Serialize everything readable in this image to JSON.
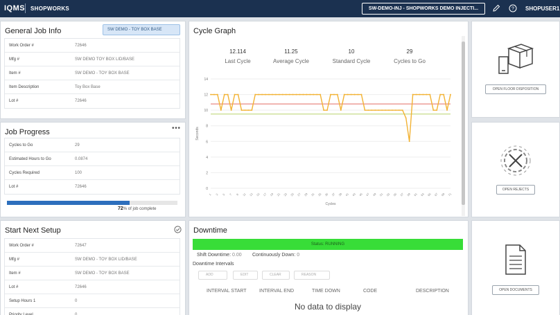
{
  "header": {
    "brand": "IQMS",
    "product": "SHOPWORKS",
    "device": "SW-DEMO-INJ - SHOPWORKS DEMO INJECTI...",
    "user": "SHOPUSER1",
    "edit_icon": "pencil-icon",
    "help_icon": "help-circle-icon"
  },
  "general_job": {
    "title": "General Job Info",
    "selector": "SW DEMO - TOY BOX BASE",
    "rows": [
      {
        "label": "Work Order #",
        "value": "72646"
      },
      {
        "label": "Mfg #",
        "value": "SW DEMO TOY BOX LID/BASE"
      },
      {
        "label": "Item #",
        "value": "SW DEMO - TOY BOX BASE"
      },
      {
        "label": "Item Description",
        "value": "Toy Box Base"
      },
      {
        "label": "Lot #",
        "value": "72646"
      }
    ]
  },
  "job_progress": {
    "title": "Job Progress",
    "rows": [
      {
        "label": "Cycles to Go",
        "value": "29"
      },
      {
        "label": "Estimated Hours to Go",
        "value": "0.0874"
      },
      {
        "label": "Cycles Required",
        "value": "100"
      },
      {
        "label": "Lot #",
        "value": "72646"
      }
    ],
    "percent": 72,
    "percent_label": "72",
    "complete_text": "% of job complete"
  },
  "next_setup": {
    "title": "Start Next Setup",
    "rows": [
      {
        "label": "Work Order #",
        "value": "72647"
      },
      {
        "label": "Mfg #",
        "value": "SW DEMO - TOY BOX LID/BASE"
      },
      {
        "label": "Item #",
        "value": "SW DEMO - TOY BOX BASE"
      },
      {
        "label": "Lot #",
        "value": "72646"
      },
      {
        "label": "Setup Hours 1",
        "value": "0"
      },
      {
        "label": "Priority Level",
        "value": "0"
      }
    ]
  },
  "cycle_graph": {
    "title": "Cycle Graph",
    "stats": [
      {
        "value": "12.114",
        "label": "Last Cycle"
      },
      {
        "value": "11.25",
        "label": "Average Cycle"
      },
      {
        "value": "10",
        "label": "Standard Cycle"
      },
      {
        "value": "29",
        "label": "Cycles to Go"
      }
    ]
  },
  "chart_data": {
    "type": "line",
    "title": "",
    "xlabel": "Cycles",
    "ylabel": "Seconds",
    "ylim": [
      0,
      14
    ],
    "yticks": [
      "0",
      "2",
      "4",
      "6",
      "8",
      "10",
      "12",
      "14"
    ],
    "x": [
      1,
      2,
      3,
      4,
      5,
      6,
      7,
      8,
      9,
      10,
      11,
      12,
      13,
      14,
      15,
      16,
      17,
      18,
      19,
      20,
      21,
      22,
      23,
      24,
      25,
      26,
      27,
      28,
      29,
      30,
      31,
      32,
      33,
      34,
      35,
      36,
      37,
      38,
      39,
      40,
      41,
      42,
      43,
      44,
      45,
      46,
      47,
      48,
      49,
      50,
      51,
      52,
      53,
      54,
      55,
      56,
      57,
      58,
      59,
      60,
      61,
      62,
      63,
      64,
      65,
      66,
      67,
      68,
      69,
      70,
      71
    ],
    "series": [
      {
        "name": "",
        "color": "#f2b233",
        "values": [
          12,
          12,
          12,
          10,
          12,
          12,
          10,
          12,
          12,
          10,
          10,
          10,
          10,
          12,
          12,
          12,
          12,
          12,
          12,
          12,
          12,
          12,
          12,
          12,
          12,
          12,
          12,
          12,
          12,
          12,
          12,
          12,
          12,
          10,
          10,
          12,
          12,
          12,
          10,
          12,
          12,
          12,
          12,
          12,
          12,
          10,
          10,
          10,
          10,
          10,
          10,
          10,
          10,
          10,
          10,
          10,
          10,
          9,
          6,
          12,
          12,
          12,
          12,
          12,
          12,
          10,
          10,
          12,
          12,
          10,
          12
        ]
      }
    ],
    "reference_lines": [
      {
        "value": 10.8,
        "color": "#e26b63"
      },
      {
        "value": 9.5,
        "color": "#b8d36b"
      }
    ],
    "grid": true
  },
  "actions": {
    "floor_disposition": {
      "label": "OPEN FLOOR DISPOSITION",
      "icon": "box-document-icon"
    },
    "rejects": {
      "label": "OPEN REJECTS",
      "icon": "rejects-gear-icon"
    },
    "documents": {
      "label": "OPEN DOCUMENTS",
      "icon": "document-icon"
    }
  },
  "downtime": {
    "title": "Downtime",
    "status": "Status: RUNNING",
    "shift_label": "Shift Downtime:",
    "shift_value": "0.00",
    "continuous_label": "Continuously Down:",
    "continuous_value": "0",
    "intervals_label": "Downtime Intervals",
    "buttons": [
      "ADD",
      "EDIT",
      "CLEAR",
      "REASON"
    ],
    "columns": [
      "INTERVAL START",
      "INTERVAL END",
      "TIME DOWN",
      "CODE",
      "DESCRIPTION"
    ],
    "empty_text": "No data to display"
  }
}
